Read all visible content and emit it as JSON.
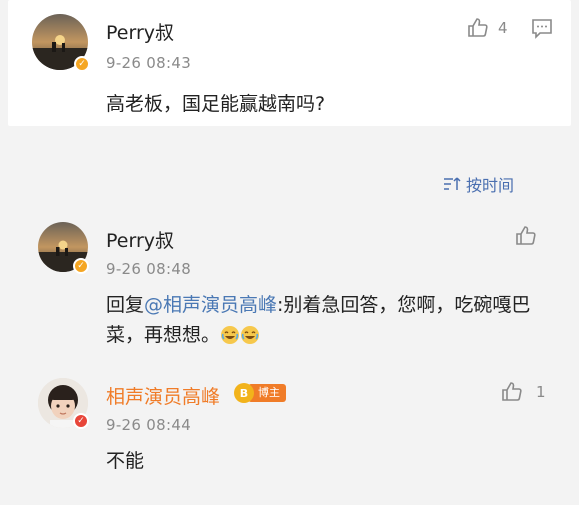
{
  "post": {
    "username": "Perry叔",
    "time": "9-26 08:43",
    "likes": "4",
    "content": "高老板，国足能赢越南吗?"
  },
  "sort": {
    "label": "按时间"
  },
  "reply1": {
    "username": "Perry叔",
    "time": "9-26 08:48",
    "reply_prefix": "回复",
    "mention": "@相声演员高峰",
    "content_rest": ":别着急回答，您啊，吃碗嘎巴菜，再想想。",
    "emoji": [
      "laugh-cry",
      "laugh-cry"
    ]
  },
  "reply2": {
    "username": "相声演员高峰",
    "tag": "博主",
    "time": "9-26 08:44",
    "likes": "1",
    "content": "不能"
  },
  "icons": {
    "like": "thumbs-up-icon",
    "comment": "comment-icon",
    "sort": "sort-icon",
    "verified": "verified-badge"
  },
  "colors": {
    "link": "#4a78b4",
    "blogger_name": "#f07c28",
    "verified_gold": "#f5a623",
    "verified_red": "#e8463a"
  }
}
